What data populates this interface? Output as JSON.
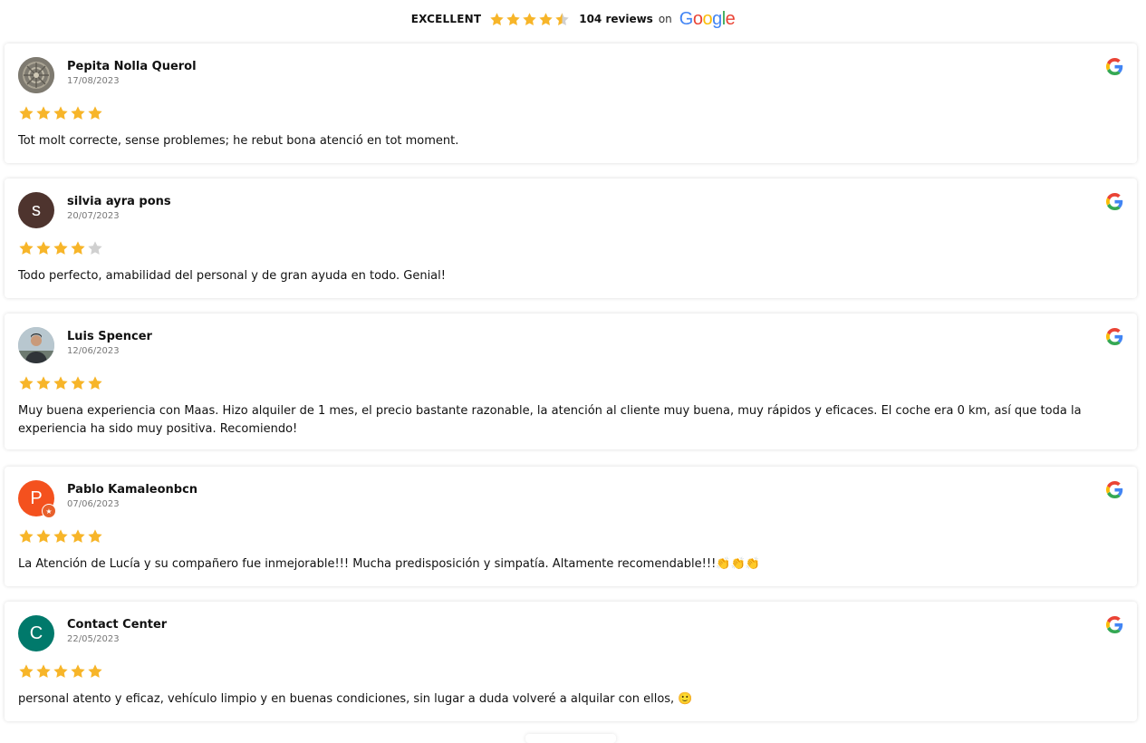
{
  "summary": {
    "label": "EXCELLENT",
    "rating_stars": 4.5,
    "count_text": "104 reviews",
    "on_text": "on",
    "logo_text": "Google"
  },
  "colors": {
    "star": "#f7b529",
    "star_empty": "#d0d0d0",
    "google_blue": "#4285f4",
    "google_red": "#ea4335",
    "google_yellow": "#fbbc05",
    "google_green": "#34a853"
  },
  "reviews": [
    {
      "name": "Pepita Nolla Querol",
      "date": "17/08/2023",
      "rating": 5,
      "text": "Tot molt correcte, sense problemes; he rebut bona atenció en tot moment.",
      "avatar": {
        "type": "photo",
        "icon": "stone-pattern-photo",
        "bg": "#7d7a72"
      }
    },
    {
      "name": "silvia ayra pons",
      "date": "20/07/2023",
      "rating": 4,
      "text": "Todo perfecto, amabilidad del personal y de gran ayuda en todo. Genial!",
      "avatar": {
        "type": "letter",
        "letter": "s",
        "bg": "#4e342e"
      }
    },
    {
      "name": "Luis Spencer",
      "date": "12/06/2023",
      "rating": 5,
      "text": "Muy buena experiencia con Maas. Hizo alquiler de 1 mes, el precio bastante razonable, la atención al cliente muy buena, muy rápidos y eficaces. El coche era 0 km, así que toda la experiencia ha sido muy positiva. Recomiendo!",
      "avatar": {
        "type": "photo",
        "icon": "person-photo",
        "bg": "#8fa3ad"
      }
    },
    {
      "name": "Pablo Kamaleonbcn",
      "date": "07/06/2023",
      "rating": 5,
      "text": "La Atención de Lucía y su compañero fue inmejorable!!! Mucha predisposición y simpatía. Altamente recomendable!!!👏👏👏",
      "avatar": {
        "type": "letter",
        "letter": "P",
        "bg": "#f4511e",
        "badge": true
      }
    },
    {
      "name": "Contact Center",
      "date": "22/05/2023",
      "rating": 5,
      "text": "personal atento y eficaz, vehículo limpio y en buenas condiciones, sin lugar a duda volveré a alquilar con ellos, 🙂",
      "avatar": {
        "type": "letter",
        "letter": "C",
        "bg": "#00796b"
      }
    }
  ]
}
